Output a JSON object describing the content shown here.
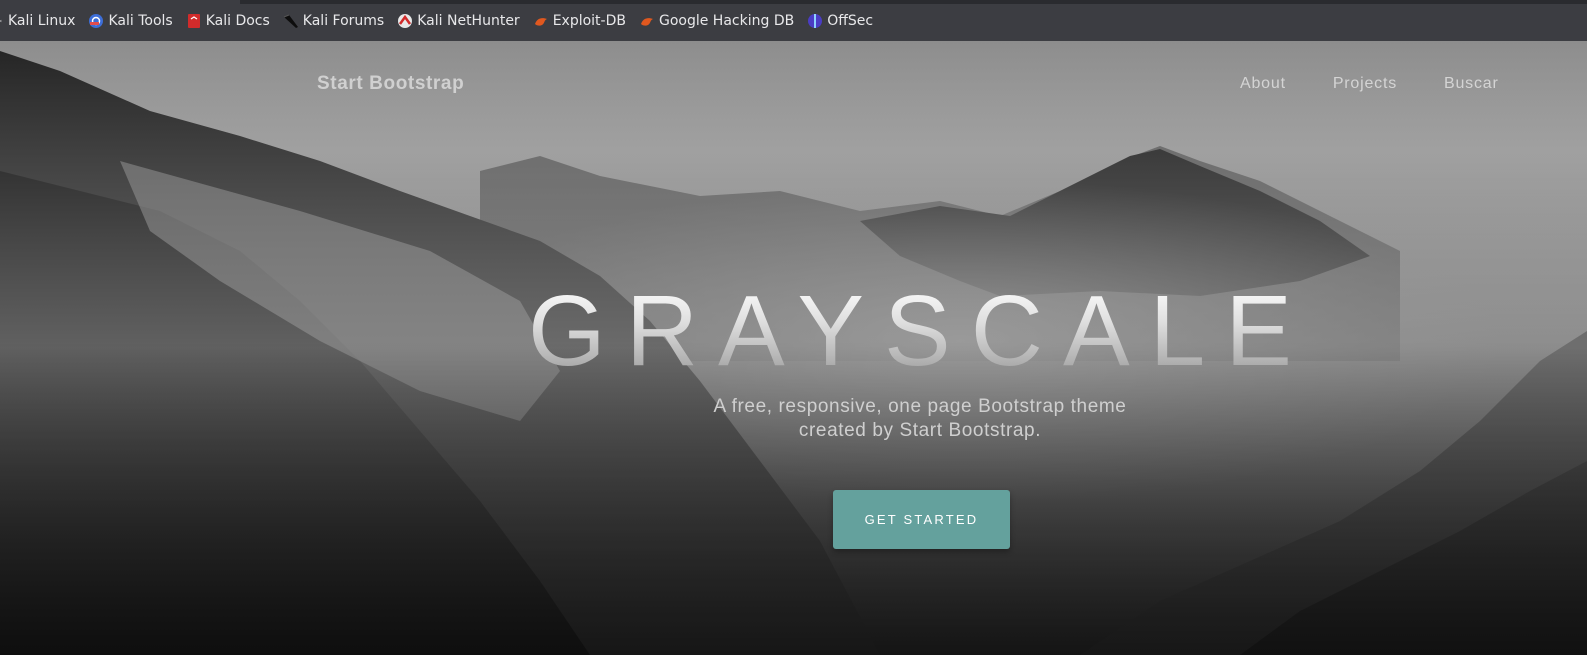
{
  "bookmarks": [
    {
      "label": "Kali Linux",
      "icon": "kali-dragon-icon"
    },
    {
      "label": "Kali Tools",
      "icon": "kali-tools-icon"
    },
    {
      "label": "Kali Docs",
      "icon": "kali-docs-icon"
    },
    {
      "label": "Kali Forums",
      "icon": "kali-forums-icon"
    },
    {
      "label": "Kali NetHunter",
      "icon": "kali-nethunter-icon"
    },
    {
      "label": "Exploit-DB",
      "icon": "exploit-db-icon"
    },
    {
      "label": "Google Hacking DB",
      "icon": "google-hacking-db-icon"
    },
    {
      "label": "OffSec",
      "icon": "offsec-icon"
    }
  ],
  "navbar": {
    "brand": "Start Bootstrap",
    "links": [
      "About",
      "Projects",
      "Buscar"
    ]
  },
  "hero": {
    "title": "GRAYSCALE",
    "subtitle_line1": "A free, responsive, one page Bootstrap theme",
    "subtitle_line2": "created by Start Bootstrap.",
    "cta_label": "GET STARTED"
  },
  "colors": {
    "bookmark_bar": "#3c3d42",
    "cta_button": "#64a19d",
    "nav_text": "#d4d4d4"
  }
}
